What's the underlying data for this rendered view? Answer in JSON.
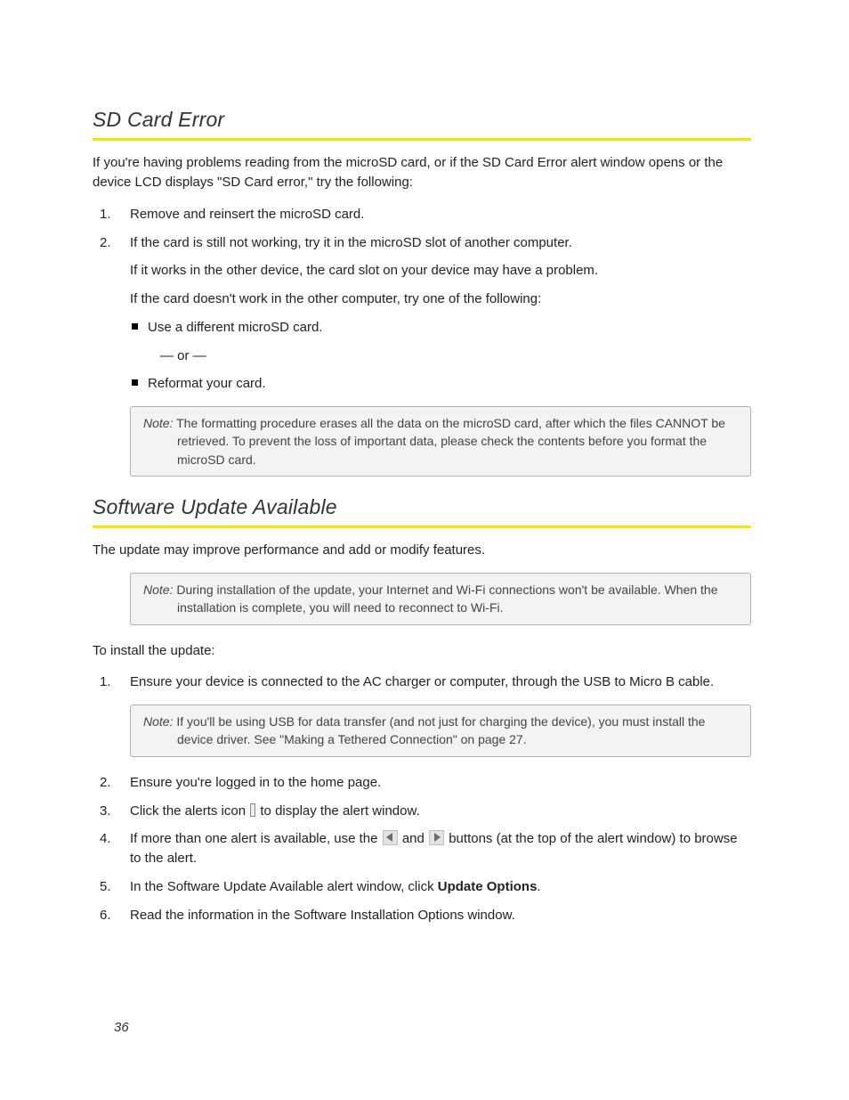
{
  "section1": {
    "title": "SD Card Error",
    "intro": "If you're having problems reading from the microSD card, or if the SD Card Error alert window opens or the device LCD displays \"SD Card error,\" try the following:",
    "step1": "Remove and reinsert the microSD card.",
    "step2_a": "If the card is still not working, try it in the microSD slot of another computer.",
    "step2_b": "If it works in the other device, the card slot on your device may have a problem.",
    "step2_c": "If the card doesn't work in the other computer, try one of the following:",
    "bullet1": "Use a different microSD card.",
    "or": "— or —",
    "bullet2": "Reformat your card.",
    "note_label": "Note:",
    "note_text": "The formatting procedure erases all the data on the microSD card, after which the files CANNOT be retrieved. To prevent the loss of important data, please check the contents before you format the microSD card."
  },
  "section2": {
    "title": "Software Update Available",
    "intro": "The update may improve performance and add or modify features.",
    "note1_label": "Note:",
    "note1_text": "During installation of the update, your Internet and Wi-Fi connections won't be available. When the installation is complete, you will need to reconnect to Wi-Fi.",
    "lead": "To install the update:",
    "step1": "Ensure your device is connected to the AC charger or computer, through the USB to Micro B cable.",
    "note2_label": "Note:",
    "note2_text": "If you'll be using USB for data transfer (and not just for charging the device), you must install the device driver. See \"Making a Tethered Connection\" on page 27.",
    "step2": "Ensure you're logged in to the home page.",
    "step3_a": "Click the alerts icon ",
    "step3_b": " to display the alert window.",
    "step4_a": "If more than one alert is available, use the ",
    "step4_b": " and ",
    "step4_c": " buttons (at the top of the alert window) to browse to the alert.",
    "step5_a": "In the Software Update Available alert window, click ",
    "step5_bold": "Update Options",
    "step5_b": ".",
    "step6": "Read the information in the Software Installation Options window."
  },
  "page_number": "36",
  "nums": {
    "n1": "1.",
    "n2": "2.",
    "n3": "3.",
    "n4": "4.",
    "n5": "5.",
    "n6": "6."
  }
}
